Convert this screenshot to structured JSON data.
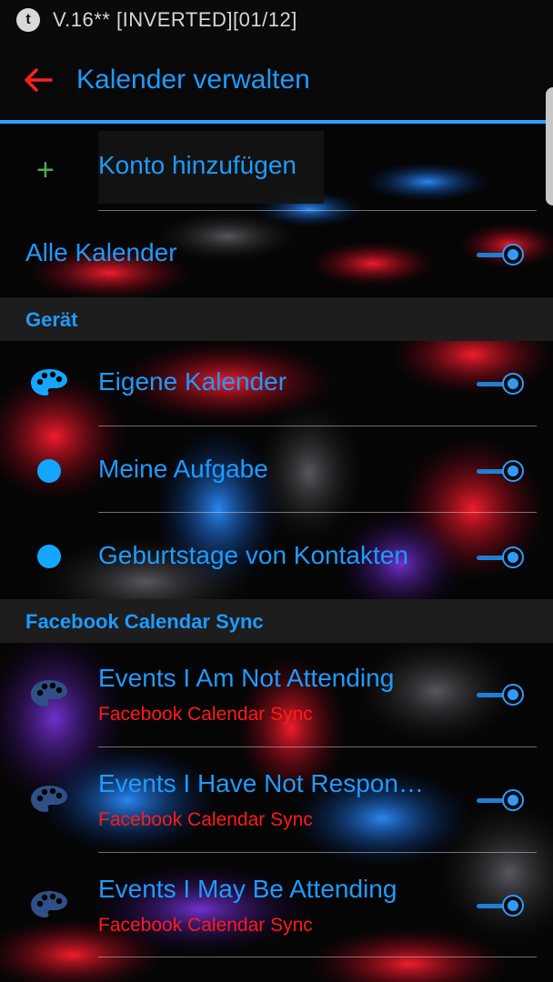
{
  "status_bar": {
    "icon_letter": "t",
    "text": "V.16** [INVERTED][01/12]"
  },
  "app_bar": {
    "title": "Kalender verwalten"
  },
  "add_account": {
    "label": "Konto hinzufügen"
  },
  "all_calendars": {
    "label": "Alle Kalender",
    "enabled": true
  },
  "sections": [
    {
      "title": "Gerät",
      "items": [
        {
          "label": "Eigene Kalender",
          "icon": "palette-icon",
          "enabled": true
        },
        {
          "label": "Meine Aufgabe",
          "icon": "dot-icon",
          "enabled": true
        },
        {
          "label": "Geburtstage von Kontakten",
          "icon": "dot-icon",
          "enabled": true
        }
      ]
    },
    {
      "title": "Facebook Calendar Sync",
      "items": [
        {
          "label": "Events I Am Not Attending",
          "sublabel": "Facebook Calendar Sync",
          "icon": "palette-icon",
          "enabled": true
        },
        {
          "label": "Events I Have Not Respon…",
          "sublabel": "Facebook Calendar Sync",
          "icon": "palette-icon",
          "enabled": true
        },
        {
          "label": "Events I May Be Attending",
          "sublabel": "Facebook Calendar Sync",
          "icon": "palette-icon",
          "enabled": true
        }
      ]
    }
  ],
  "colors": {
    "accent": "#1e9bff",
    "sublabel": "#ff1a1a",
    "plus": "#4caf50",
    "back_arrow": "#ff2020"
  }
}
